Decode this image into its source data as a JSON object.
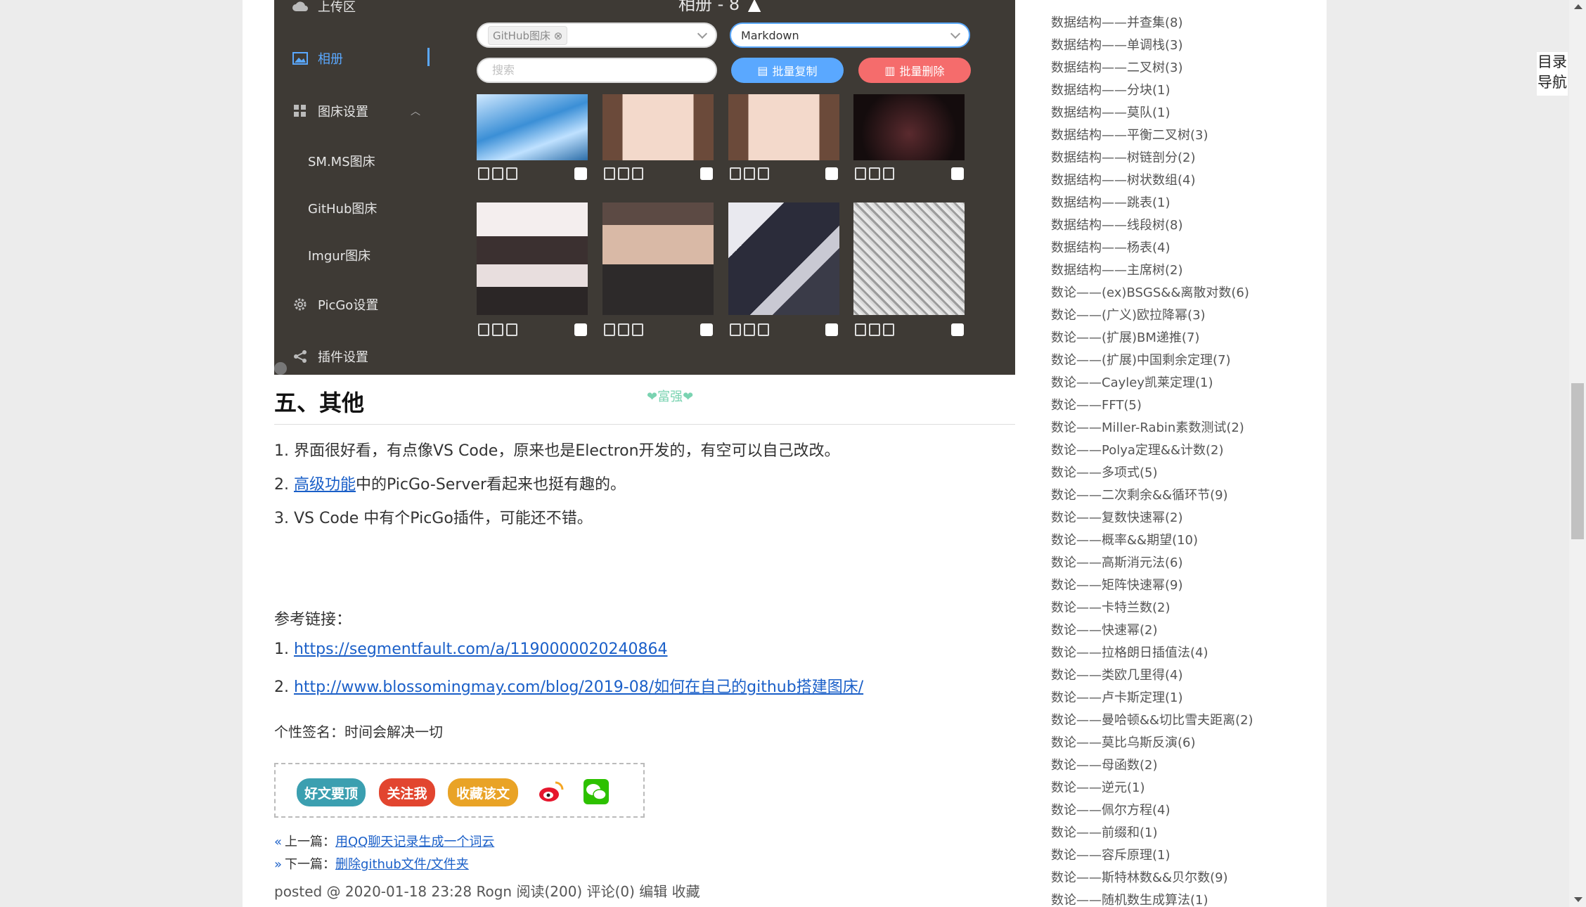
{
  "app": {
    "sidebar": {
      "upload": "上传区",
      "album": "相册",
      "bed_settings": "图床设置",
      "smms": "SM.MS图床",
      "github": "GitHub图床",
      "imgur": "Imgur图床",
      "picgo_settings": "PicGo设置",
      "plugin_settings": "插件设置"
    },
    "album_title": "相册 - 8",
    "bed_select": "GitHub图床",
    "format_select": "Markdown",
    "search_placeholder": "搜索",
    "batch_copy": "批量复制",
    "batch_delete": "批量删除"
  },
  "article": {
    "heading": "五、其他",
    "deco": "❤富强❤",
    "items": [
      "1. 界面很好看，有点像VS Code，原来也是Electron开发的，有空可以自己改改。",
      "中的PicGo-Server看起来也挺有趣的。",
      "3. VS Code 中有个PicGo插件，可能还不错。"
    ],
    "item2_prefix": "2. ",
    "item2_link": "高级功能",
    "refs_label": "参考链接：",
    "ref1_num": "1. ",
    "ref1": "https://segmentfault.com/a/1190000020240864",
    "ref2_num": "2. ",
    "ref2": "http://www.blossomingmay.com/blog/2019-08/如何在自己的github搭建图床/",
    "signature": "个性签名：时间会解决一切",
    "buttons": {
      "recommend": "好文要顶",
      "follow": "关注我",
      "favorite": "收藏该文"
    },
    "prev_label": "上一篇：",
    "prev_link": "用QQ聊天记录生成一个词云",
    "next_label": "下一篇：",
    "next_link": "删除github文件/文件夹",
    "meta": "posted @ 2020-01-18 23:28  Rogn  阅读(200)  评论(0)  编辑  收藏"
  },
  "categories": [
    "数据结构——并查集(8)",
    "数据结构——单调栈(3)",
    "数据结构——二叉树(3)",
    "数据结构——分块(1)",
    "数据结构——莫队(1)",
    "数据结构——平衡二叉树(3)",
    "数据结构——树链剖分(2)",
    "数据结构——树状数组(4)",
    "数据结构——跳表(1)",
    "数据结构——线段树(8)",
    "数据结构——杨表(4)",
    "数据结构——主席树(2)",
    "数论——(ex)BSGS&&离散对数(6)",
    "数论——(广义)欧拉降幂(3)",
    "数论——(扩展)BM递推(7)",
    "数论——(扩展)中国剩余定理(7)",
    "数论——Cayley凯莱定理(1)",
    "数论——FFT(5)",
    "数论——Miller-Rabin素数测试(2)",
    "数论——Polya定理&&计数(2)",
    "数论——多项式(5)",
    "数论——二次剩余&&循环节(9)",
    "数论——复数快速幂(2)",
    "数论——概率&&期望(10)",
    "数论——高斯消元法(6)",
    "数论——矩阵快速幂(9)",
    "数论——卡特兰数(2)",
    "数论——快速幂(2)",
    "数论——拉格朗日插值法(4)",
    "数论——类欧几里得(4)",
    "数论——卢卡斯定理(1)",
    "数论——曼哈顿&&切比雪夫距离(2)",
    "数论——莫比乌斯反演(6)",
    "数论——母函数(2)",
    "数论——逆元(1)",
    "数论——佩尔方程(4)",
    "数论——前缀和(1)",
    "数论——容斥原理(1)",
    "数论——斯特林数&&贝尔数(9)",
    "数论——随机数生成算法(1)"
  ],
  "toc": {
    "line1": "目录",
    "line2": "导航"
  },
  "colors": {
    "link": "#1a5fc8",
    "app_bg": "#3e3a35",
    "accent": "#5aa8ff",
    "danger": "#f56c6c"
  }
}
